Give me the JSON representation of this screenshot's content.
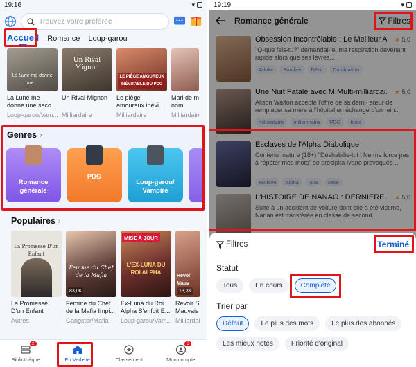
{
  "left": {
    "status": {
      "time": "19:16"
    },
    "search": {
      "placeholder": "Trouvez votre préférée"
    },
    "gift_badge": "1",
    "tabs": [
      {
        "label": "Accueil",
        "active": true
      },
      {
        "label": "Romance",
        "active": false
      },
      {
        "label": "Loup-garou",
        "active": false
      }
    ],
    "top_books": [
      {
        "title": "La Lune me donne une seco...",
        "genre": "Loup-garou/Vam...",
        "cover_color": "#7a7468",
        "cover_text": "La Lune me donne une ..."
      },
      {
        "title": "Un Rival Mignon",
        "genre": "Milliardaire",
        "cover_color": "#5e5247",
        "cover_text": "Un Rival Mignon"
      },
      {
        "title": "Le piège amoureux inévi...",
        "genre": "Milliardaire",
        "cover_color": "#a84b3a",
        "cover_text": "LE PIÈGE AMOUREUX INÉVITABLE DU PDG"
      },
      {
        "title": "Mari de m nom",
        "genre": "Milliardaire",
        "cover_color": "#c99a8e",
        "cover_text": ""
      }
    ],
    "genres": {
      "title": "Genres",
      "items": [
        {
          "label": "Romance générale",
          "color": "#9b6cf0",
          "thumb": "#c08a68"
        },
        {
          "label": "PDG",
          "color": "#f58a3a",
          "thumb": "#333b48"
        },
        {
          "label": "Loup-garou/ Vampire",
          "color": "#2fb0e0",
          "thumb": "#4a5560"
        }
      ]
    },
    "populaires": {
      "title": "Populaires",
      "items": [
        {
          "title": "La Promesse D'un Enfant",
          "genre": "Autres",
          "cover_color": "#e8e4de",
          "cover_text": "La Promesse D'un Enfant",
          "badge": "",
          "views": ""
        },
        {
          "title": "Femme du Chef de la Mafia Impi...",
          "genre": "Gangster/Mafia",
          "cover_color": "#5a3a34",
          "cover_text": "Femme du Chef de la Mafia",
          "badge": "",
          "views": "83,0K"
        },
        {
          "title": "Ex-Luna du Roi Alpha S'enfuit E...",
          "genre": "Loup-garou/Vam...",
          "cover_color": "#6d2f2c",
          "cover_text": "L'EX-LUNA DU ROI ALPHA",
          "badge": "MISE À JOUR",
          "views": ""
        },
        {
          "title": "Revoir S Mauvais",
          "genre": "Milliardaire",
          "cover_color": "#8a4a3a",
          "cover_text": "Revoi Mauv",
          "badge": "",
          "views": "13,3K"
        }
      ]
    },
    "bottom_nav": [
      {
        "label": "Bibliothèque",
        "badge": "2",
        "active": false
      },
      {
        "label": "En Vedette",
        "badge": "",
        "active": true
      },
      {
        "label": "Classement",
        "badge": "",
        "active": false
      },
      {
        "label": "Mon compte",
        "badge": "3",
        "active": false
      }
    ]
  },
  "right": {
    "status": {
      "time": "19:19"
    },
    "header": {
      "title": "Romance générale",
      "filter_label": "Filtres"
    },
    "books": [
      {
        "title": "Obsession Incontrôlable : Le Meilleur A...",
        "rating": "5,0",
        "desc": "\"Q-que fais-tu?\" demandai-je, ma respiration devenant rapide alors que ses lèvres...",
        "tags": [
          "Adulte",
          "Sombre",
          "Désir",
          "Domination"
        ],
        "thumb": "#c89a7a"
      },
      {
        "title": "Une Nuit Fatale avec M.Multi-milliardai...",
        "rating": "5,0",
        "desc": "Alison Walton accepte l'offre de sa demi- sœur de remplacer sa mère à l'hôpital en échange d'un rein...",
        "tags": [
          "milliardaire",
          "millionnaire",
          "PDG",
          "boss"
        ],
        "thumb": "#6e5a52"
      },
      {
        "title": "Esclaves de l'Alpha Diabolique",
        "rating": "",
        "desc": "Contenu mature (18+) \"Déshabille-toi ! Ne me force pas à répéter mes mots\" se précipita Ivano provoquée ...",
        "tags": [
          "esclave",
          "alpha",
          "luna",
          "sexe"
        ],
        "thumb": "#3a3c5e"
      },
      {
        "title": "L'HISTOIRE DE NANAO : DERNIÈRE AN...",
        "rating": "5,0",
        "desc": "Suite à un accident de voiture dont elle a été victime, Nanao est transférée en classe de second...",
        "tags": [],
        "thumb": "#a59e97"
      }
    ],
    "sheet": {
      "title": "Filtres",
      "done_label": "Terminé",
      "statut_label": "Statut",
      "statut_options": [
        {
          "label": "Tous",
          "selected": false
        },
        {
          "label": "En cours",
          "selected": false
        },
        {
          "label": "Complété",
          "selected": true
        }
      ],
      "sort_label": "Trier par",
      "sort_options": [
        {
          "label": "Défaut",
          "selected": true
        },
        {
          "label": "Le plus des mots",
          "selected": false
        },
        {
          "label": "Le plus des abonnés",
          "selected": false
        },
        {
          "label": "Les mieux notés",
          "selected": false
        },
        {
          "label": "Priorité d'original",
          "selected": false
        }
      ]
    }
  },
  "colors": {
    "accent": "#1a5fd1",
    "highlight": "#e0151b",
    "star": "#f5a623"
  }
}
